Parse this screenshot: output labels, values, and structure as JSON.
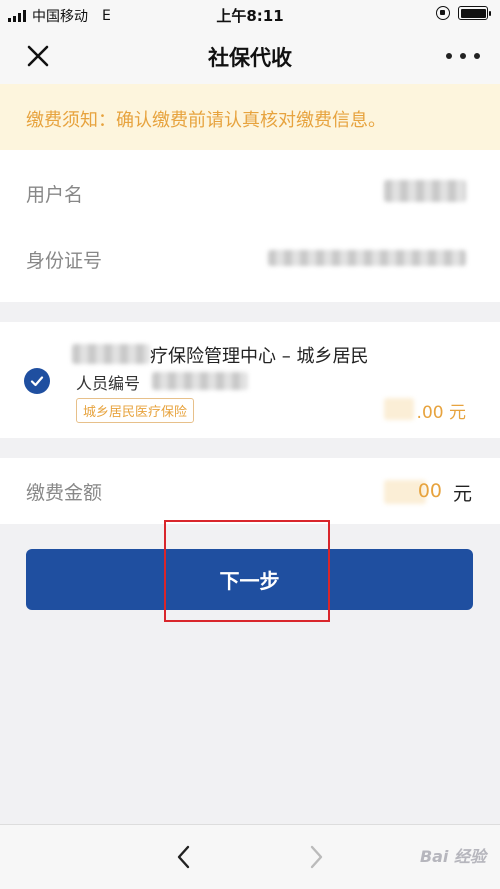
{
  "status_bar": {
    "carrier": "中国移动",
    "network": "E",
    "time": "上午8:11"
  },
  "nav": {
    "title": "社保代收",
    "close_icon": "close-icon",
    "more_icon": "more-dots-icon"
  },
  "notice": {
    "text": "缴费须知：确认缴费前请认真核对缴费信息。"
  },
  "info": {
    "username_label": "用户名",
    "id_label": "身份证号"
  },
  "item": {
    "title": "疗保险管理中心 – 城乡居民",
    "sub_label": "人员编号",
    "tag": "城乡居民医疗保险",
    "amount": ".00 元",
    "checked": true
  },
  "total": {
    "label": "缴费金额",
    "amount": "00",
    "unit": "元"
  },
  "button": {
    "next_label": "下一步"
  },
  "bottom": {
    "back_icon": "chevron-left-icon",
    "forward_icon": "chevron-right-icon",
    "watermark": "Bai 经验"
  },
  "colors": {
    "accent": "#1f4fa0",
    "notice_bg": "#fdf5dd",
    "notice_text": "#e7a33e",
    "highlight": "#d9262b"
  }
}
